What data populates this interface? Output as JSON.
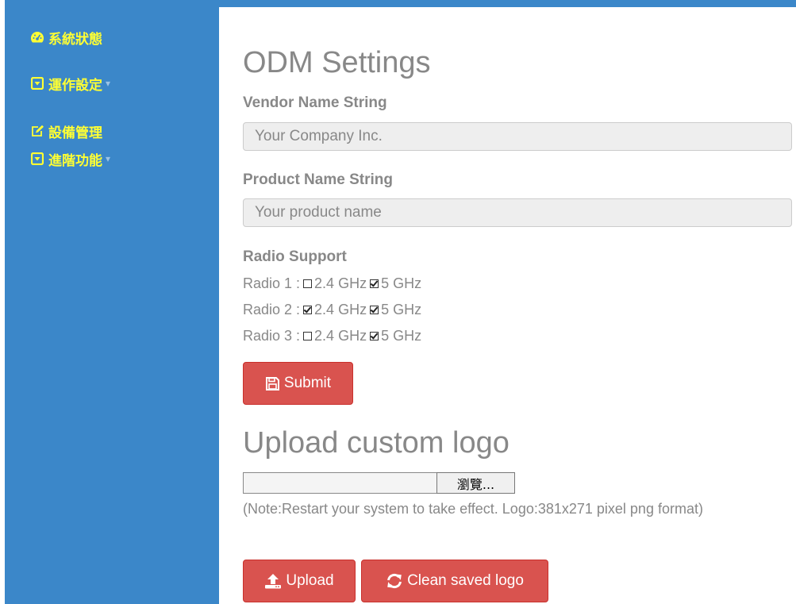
{
  "sidebar": {
    "items": [
      {
        "label": "系統狀態",
        "icon": "dashboard-icon",
        "has_caret": false
      },
      {
        "label": "運作設定",
        "icon": "caret-square-icon",
        "has_caret": true
      },
      {
        "label": "設備管理",
        "icon": "edit-icon",
        "has_caret": false
      },
      {
        "label": "進階功能",
        "icon": "caret-square-icon",
        "has_caret": true
      }
    ],
    "caret_symbol": "▾"
  },
  "odm": {
    "title": "ODM Settings",
    "vendor_label": "Vendor Name String",
    "vendor_placeholder": "Your Company Inc.",
    "vendor_value": "",
    "product_label": "Product Name String",
    "product_placeholder": "Your product name",
    "product_value": "",
    "radio_support_label": "Radio Support",
    "radios": [
      {
        "label": "Radio 1 :",
        "band24_label": "2.4 GHz",
        "band24_checked": false,
        "band5_label": "5 GHz",
        "band5_checked": true
      },
      {
        "label": "Radio 2 :",
        "band24_label": "2.4 GHz",
        "band24_checked": true,
        "band5_label": "5 GHz",
        "band5_checked": true
      },
      {
        "label": "Radio 3 :",
        "band24_label": "2.4 GHz",
        "band24_checked": false,
        "band5_label": "5 GHz",
        "band5_checked": true
      }
    ],
    "submit_label": "Submit"
  },
  "logo": {
    "title": "Upload custom logo",
    "browse_label": "瀏覽...",
    "note": "(Note:Restart your system to take effect. Logo:381x271 pixel png format)",
    "upload_label": "Upload",
    "clean_label": "Clean saved logo"
  },
  "colors": {
    "sidebar_bg": "#3b87c9",
    "nav_text": "#ffff33",
    "button_red": "#d9534f",
    "label_gray": "#888888"
  }
}
